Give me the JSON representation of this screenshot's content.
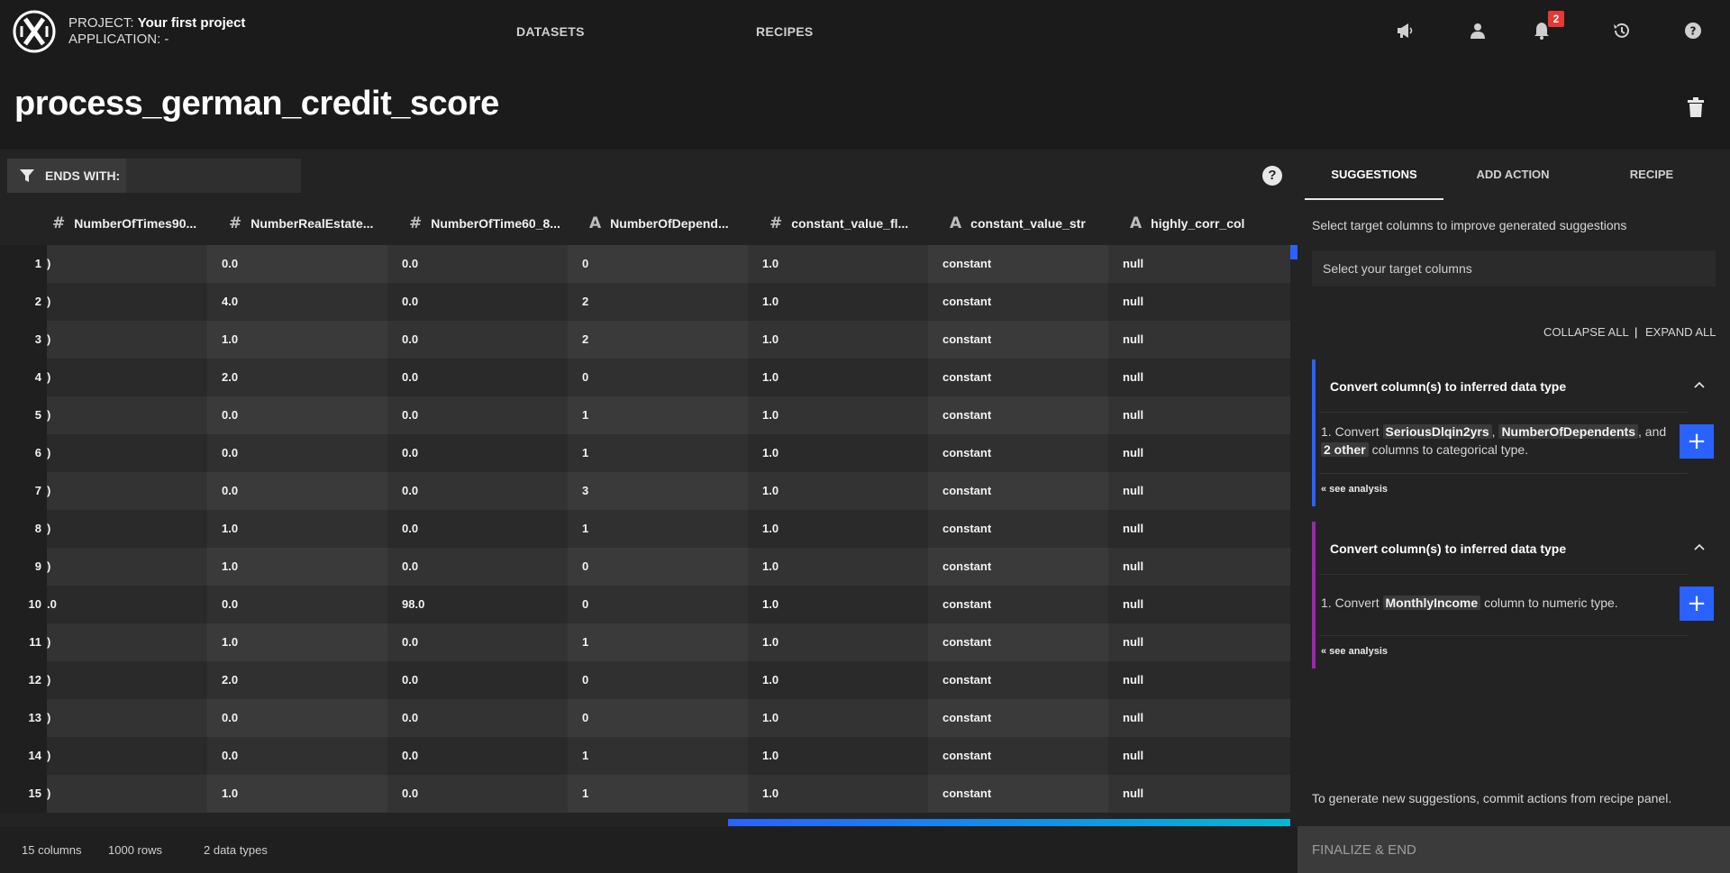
{
  "header": {
    "project_prefix": "PROJECT:",
    "project_name": "Your first project",
    "application_prefix": "APPLICATION:",
    "application_name": "-",
    "nav": [
      "DATASETS",
      "RECIPES"
    ],
    "notification_count": "2",
    "icons": [
      "megaphone-icon",
      "user-icon",
      "bell-icon",
      "history-icon",
      "help-icon"
    ]
  },
  "page": {
    "title": "process_german_credit_score"
  },
  "filter": {
    "label": "ENDS WITH:",
    "value": ""
  },
  "grid": {
    "columns": [
      {
        "type": "#",
        "name": "NumberOfTimes90..."
      },
      {
        "type": "#",
        "name": "NumberRealEstate..."
      },
      {
        "type": "#",
        "name": "NumberOfTime60_8..."
      },
      {
        "type": "A",
        "name": "NumberOfDepend..."
      },
      {
        "type": "#",
        "name": "constant_value_fl..."
      },
      {
        "type": "A",
        "name": "constant_value_str"
      },
      {
        "type": "A",
        "name": "highly_corr_col"
      }
    ],
    "rows": [
      [
        "1",
        ")",
        "0.0",
        "0.0",
        "0",
        "1.0",
        "constant",
        "null"
      ],
      [
        "2",
        ")",
        "4.0",
        "0.0",
        "2",
        "1.0",
        "constant",
        "null"
      ],
      [
        "3",
        ")",
        "1.0",
        "0.0",
        "2",
        "1.0",
        "constant",
        "null"
      ],
      [
        "4",
        ")",
        "2.0",
        "0.0",
        "0",
        "1.0",
        "constant",
        "null"
      ],
      [
        "5",
        ")",
        "0.0",
        "0.0",
        "1",
        "1.0",
        "constant",
        "null"
      ],
      [
        "6",
        ")",
        "0.0",
        "0.0",
        "1",
        "1.0",
        "constant",
        "null"
      ],
      [
        "7",
        ")",
        "0.0",
        "0.0",
        "3",
        "1.0",
        "constant",
        "null"
      ],
      [
        "8",
        ")",
        "1.0",
        "0.0",
        "1",
        "1.0",
        "constant",
        "null"
      ],
      [
        "9",
        ")",
        "1.0",
        "0.0",
        "0",
        "1.0",
        "constant",
        "null"
      ],
      [
        "10",
        ".0",
        "0.0",
        "98.0",
        "0",
        "1.0",
        "constant",
        "null"
      ],
      [
        "11",
        ")",
        "1.0",
        "0.0",
        "1",
        "1.0",
        "constant",
        "null"
      ],
      [
        "12",
        ")",
        "2.0",
        "0.0",
        "0",
        "1.0",
        "constant",
        "null"
      ],
      [
        "13",
        ")",
        "0.0",
        "0.0",
        "0",
        "1.0",
        "constant",
        "null"
      ],
      [
        "14",
        ")",
        "0.0",
        "0.0",
        "1",
        "1.0",
        "constant",
        "null"
      ],
      [
        "15",
        ")",
        "1.0",
        "0.0",
        "1",
        "1.0",
        "constant",
        "null"
      ]
    ]
  },
  "footer": {
    "columns": "15 columns",
    "rows": "1000 rows",
    "types": "2 data types"
  },
  "sidebar": {
    "tabs": [
      "SUGGESTIONS",
      "ADD ACTION",
      "RECIPE"
    ],
    "hint": "Select target columns to improve generated suggestions",
    "target_placeholder": "Select your target columns",
    "collapse_all": "COLLAPSE ALL",
    "expand_all": "EXPAND ALL",
    "divider": "|",
    "cards": [
      {
        "title": "Convert column(s) to inferred data type",
        "color": "#2962ff",
        "num": "1.",
        "pre": "Convert",
        "chips": [
          "SeriousDlqin2yrs",
          "NumberOfDependents",
          "2 other"
        ],
        "mid1": ",",
        "mid2": ", and",
        "post": "columns to categorical type.",
        "see": "« see analysis"
      },
      {
        "title": "Convert column(s) to inferred data type",
        "color": "#9c27b0",
        "num": "1.",
        "pre": "Convert",
        "chip": "MonthlyIncome",
        "post": "column to numeric type.",
        "see": "« see analysis"
      }
    ],
    "bottom_hint": "To generate new suggestions, commit actions from recipe panel.",
    "finalize": "FINALIZE & END"
  }
}
